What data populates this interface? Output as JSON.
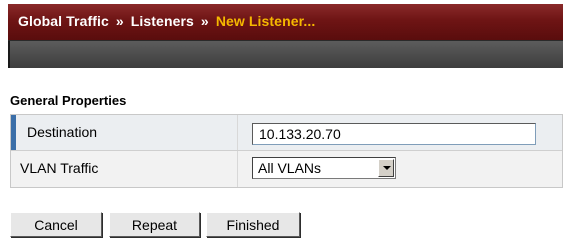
{
  "header": {
    "breadcrumb": [
      "Global Traffic",
      "Listeners",
      "New Listener..."
    ],
    "separator": "»"
  },
  "section": {
    "title": "General Properties"
  },
  "form": {
    "destination": {
      "label": "Destination",
      "value": "10.133.20.70"
    },
    "vlan_traffic": {
      "label": "VLAN Traffic",
      "selected": "All VLANs"
    }
  },
  "buttons": {
    "cancel": "Cancel",
    "repeat": "Repeat",
    "finished": "Finished"
  },
  "colors": {
    "header_bg": "#6e1414",
    "breadcrumb_current": "#f5b800",
    "row_accent": "#3a6ea8"
  }
}
